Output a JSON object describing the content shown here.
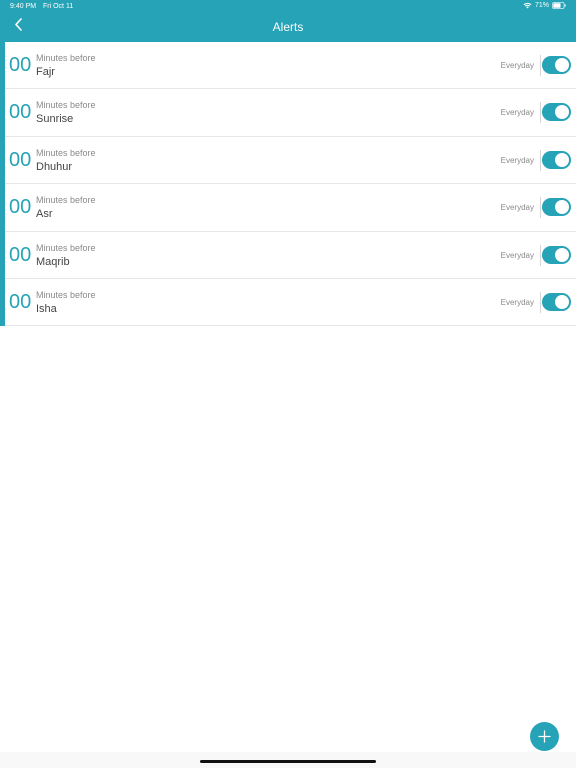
{
  "status_bar": {
    "time": "9:40 PM",
    "date": "Fri Oct 11",
    "battery": "71%"
  },
  "header": {
    "title": "Alerts",
    "back_icon": "chevron-left-icon"
  },
  "colors": {
    "accent": "#26a3b6",
    "text_secondary": "#8a8a8a",
    "text_primary": "#444444"
  },
  "alerts": [
    {
      "minutes": "00",
      "subtitle": "Minutes before",
      "prayer": "Fajr",
      "repeat": "Everyday",
      "enabled": true
    },
    {
      "minutes": "00",
      "subtitle": "Minutes before",
      "prayer": "Sunrise",
      "repeat": "Everyday",
      "enabled": true
    },
    {
      "minutes": "00",
      "subtitle": "Minutes before",
      "prayer": "Dhuhur",
      "repeat": "Everyday",
      "enabled": true
    },
    {
      "minutes": "00",
      "subtitle": "Minutes before",
      "prayer": "Asr",
      "repeat": "Everyday",
      "enabled": true
    },
    {
      "minutes": "00",
      "subtitle": "Minutes before",
      "prayer": "Maqrib",
      "repeat": "Everyday",
      "enabled": true
    },
    {
      "minutes": "00",
      "subtitle": "Minutes before",
      "prayer": "Isha",
      "repeat": "Everyday",
      "enabled": true
    }
  ],
  "fab": {
    "icon": "plus-icon"
  }
}
